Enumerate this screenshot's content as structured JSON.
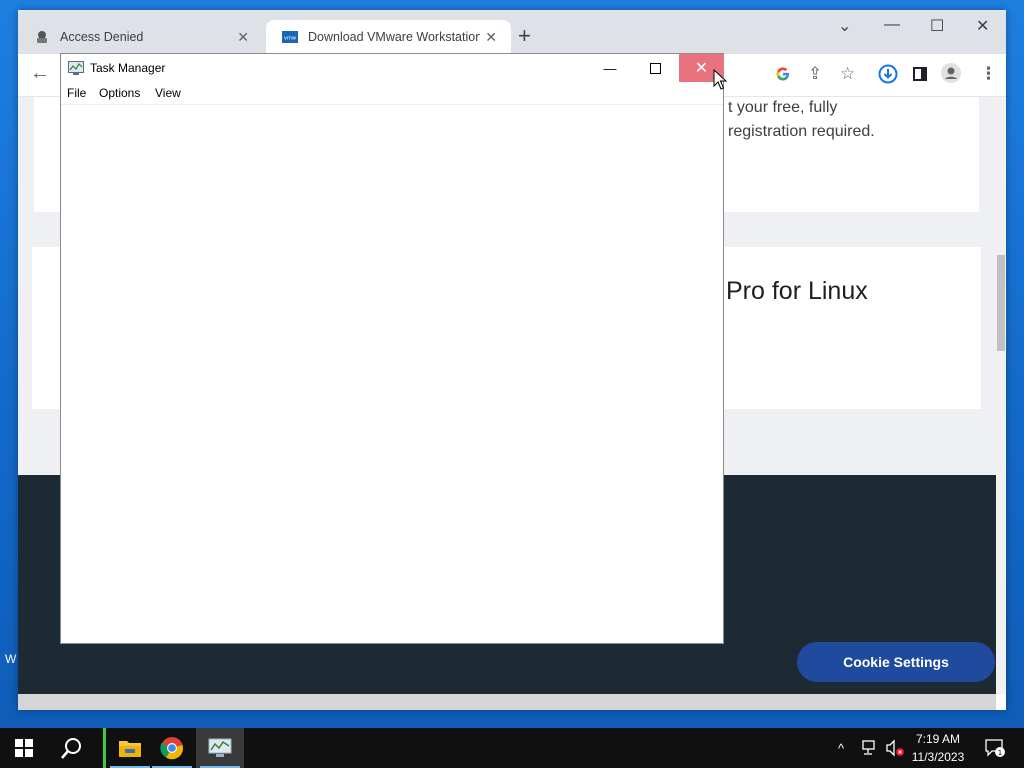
{
  "browser": {
    "tabs": [
      {
        "title": "Access Denied",
        "active": false
      },
      {
        "title": "Download VMware Workstation P",
        "active": true
      }
    ],
    "new_tab_icon": "plus-icon",
    "toolbar_icons": [
      "back-icon",
      "google-icon",
      "share-icon",
      "star-icon",
      "download-icon",
      "sidepanel-icon",
      "profile-icon",
      "menu-icon"
    ],
    "page": {
      "card1_line1": "t your free, fully",
      "card1_line2": "registration required.",
      "card2_title": "Pro for Linux",
      "cookie_button": "Cookie Settings"
    }
  },
  "desktop": {
    "partial_text": "W"
  },
  "task_manager": {
    "title": "Task Manager",
    "menu": [
      "File",
      "Options",
      "View"
    ],
    "close_color": "#e8737f"
  },
  "taskbar": {
    "time": "7:19 AM",
    "date": "11/3/2023",
    "notification_count": "1",
    "pinned": [
      "start-icon",
      "search-icon",
      "file-explorer-icon",
      "chrome-icon",
      "task-manager-icon"
    ]
  }
}
